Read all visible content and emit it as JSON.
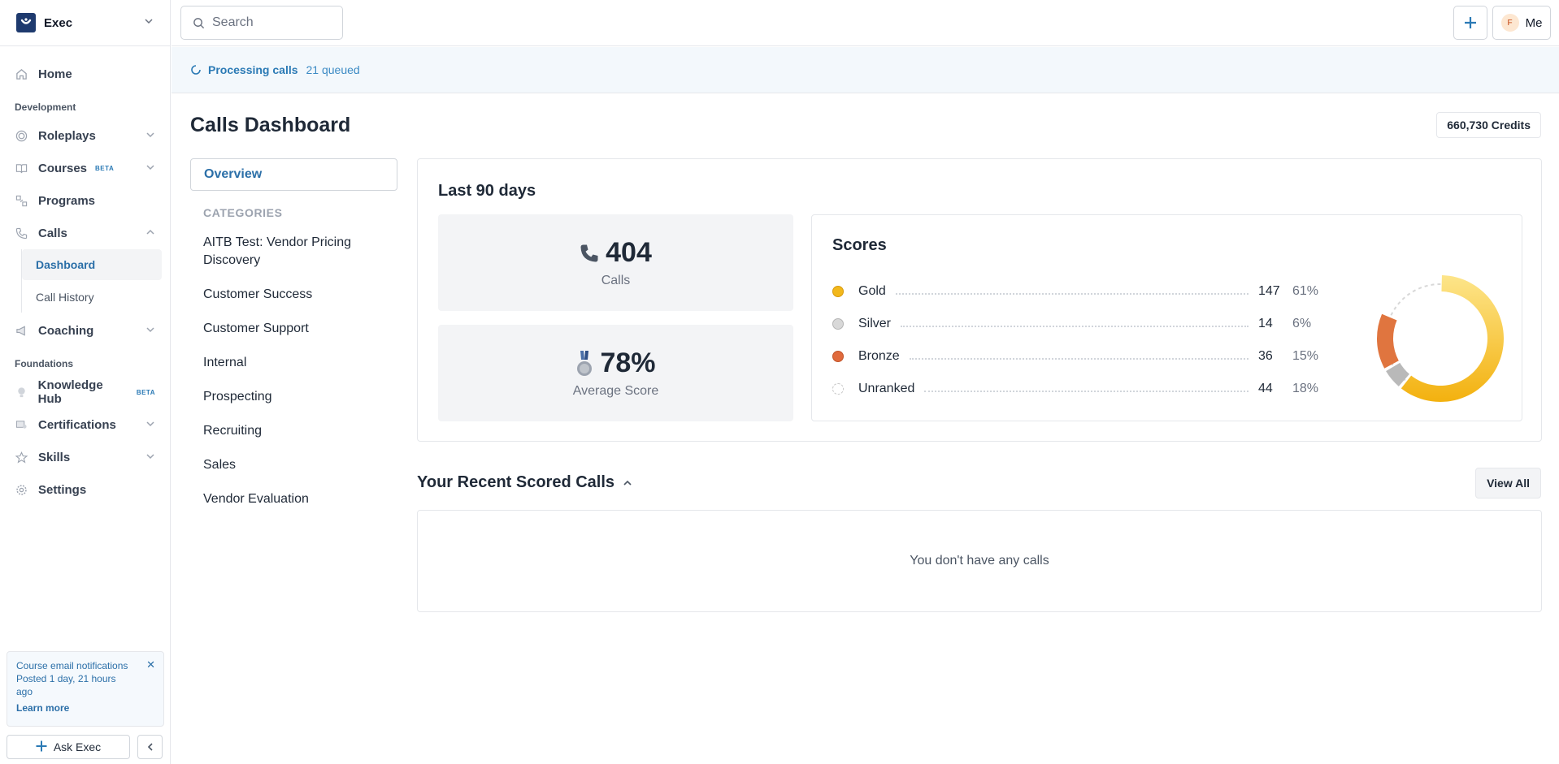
{
  "workspace": {
    "name": "Exec"
  },
  "sidebar": {
    "home": "Home",
    "section_development": "Development",
    "roleplays": "Roleplays",
    "courses": "Courses",
    "courses_badge": "BETA",
    "programs": "Programs",
    "calls": "Calls",
    "calls_sub": {
      "dashboard": "Dashboard",
      "history": "Call History"
    },
    "coaching": "Coaching",
    "section_foundations": "Foundations",
    "knowledge_hub": "Knowledge Hub",
    "knowledge_badge": "BETA",
    "certifications": "Certifications",
    "skills": "Skills",
    "settings": "Settings"
  },
  "notification": {
    "title": "Course email notifications",
    "posted": "Posted 1 day, 21 hours ago",
    "link": "Learn more"
  },
  "ask": {
    "label": "Ask Exec"
  },
  "topbar": {
    "search_placeholder": "Search",
    "user_label": "Me",
    "user_initial": "F"
  },
  "banner": {
    "status": "Processing calls",
    "queued": "21 queued"
  },
  "page": {
    "title": "Calls Dashboard",
    "credits": "660,730 Credits"
  },
  "categories_panel": {
    "overview": "Overview",
    "heading": "CATEGORIES",
    "items": [
      "AITB Test: Vendor Pricing Discovery",
      "Customer Success",
      "Customer Support",
      "Internal",
      "Prospecting",
      "Recruiting",
      "Sales",
      "Vendor Evaluation"
    ]
  },
  "stats": {
    "period": "Last 90 days",
    "calls_value": "404",
    "calls_label": "Calls",
    "score_value": "78%",
    "score_label": "Average Score"
  },
  "scores": {
    "title": "Scores",
    "rows": [
      {
        "name": "Gold",
        "count": "147",
        "pct": "61%",
        "color": "#f2b81c"
      },
      {
        "name": "Silver",
        "count": "14",
        "pct": "6%",
        "color": "#c7c7c7"
      },
      {
        "name": "Bronze",
        "count": "36",
        "pct": "15%",
        "color": "#e06a3c"
      },
      {
        "name": "Unranked",
        "count": "44",
        "pct": "18%",
        "color": "#ffffff"
      }
    ]
  },
  "recent": {
    "title": "Your Recent Scored Calls",
    "view_all": "View All",
    "empty": "You don't have any calls"
  }
}
